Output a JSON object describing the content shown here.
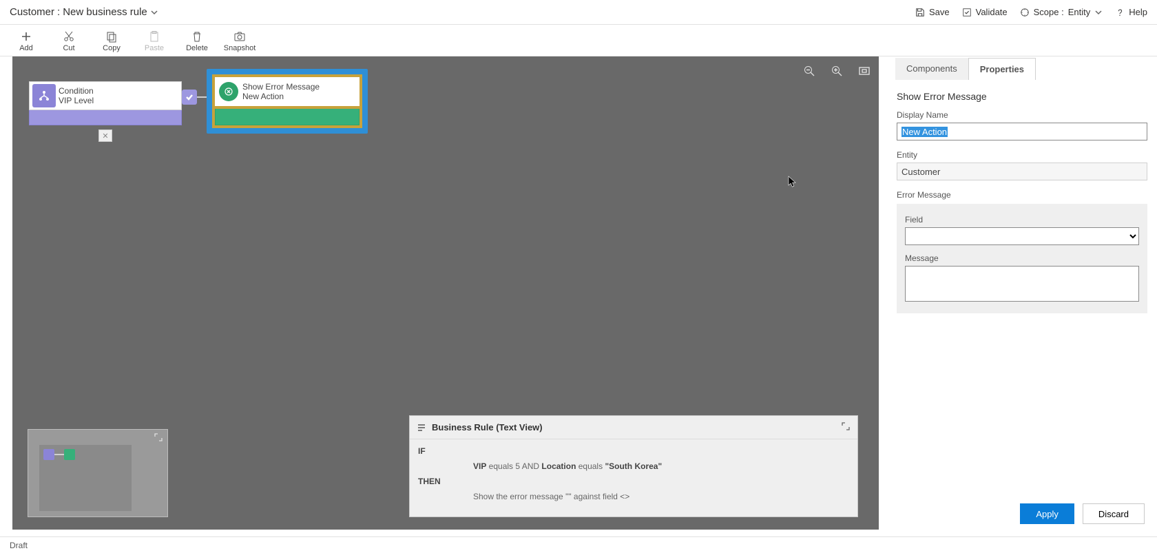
{
  "header": {
    "entity_label": "Customer",
    "separator": ":",
    "rule_name": "New business rule",
    "actions": {
      "save": "Save",
      "validate": "Validate",
      "scope_label": "Scope :",
      "scope_value": "Entity",
      "help": "Help"
    }
  },
  "toolbar": {
    "add": "Add",
    "cut": "Cut",
    "copy": "Copy",
    "paste": "Paste",
    "delete": "Delete",
    "snapshot": "Snapshot"
  },
  "canvas": {
    "condition_node": {
      "title": "Condition",
      "subtitle": "VIP Level"
    },
    "action_node": {
      "title": "Show Error Message",
      "subtitle": "New Action"
    }
  },
  "textview": {
    "title": "Business Rule (Text View)",
    "if_kw": "IF",
    "then_kw": "THEN",
    "if_line_parts": {
      "f1": "VIP",
      "op1": " equals ",
      "v1": "5",
      "conj": " AND ",
      "f2": "Location",
      "op2": " equals ",
      "v2": "\"South Korea\""
    },
    "then_line": "Show the error message \"\" against field <>"
  },
  "panel": {
    "tabs": {
      "components": "Components",
      "properties": "Properties"
    },
    "section_title": "Show Error Message",
    "display_name_label": "Display Name",
    "display_name_value": "New Action",
    "entity_label": "Entity",
    "entity_value": "Customer",
    "error_message_label": "Error Message",
    "field_label": "Field",
    "field_value": "",
    "message_label": "Message",
    "message_value": "",
    "apply": "Apply",
    "discard": "Discard"
  },
  "footer": {
    "status": "Draft"
  }
}
